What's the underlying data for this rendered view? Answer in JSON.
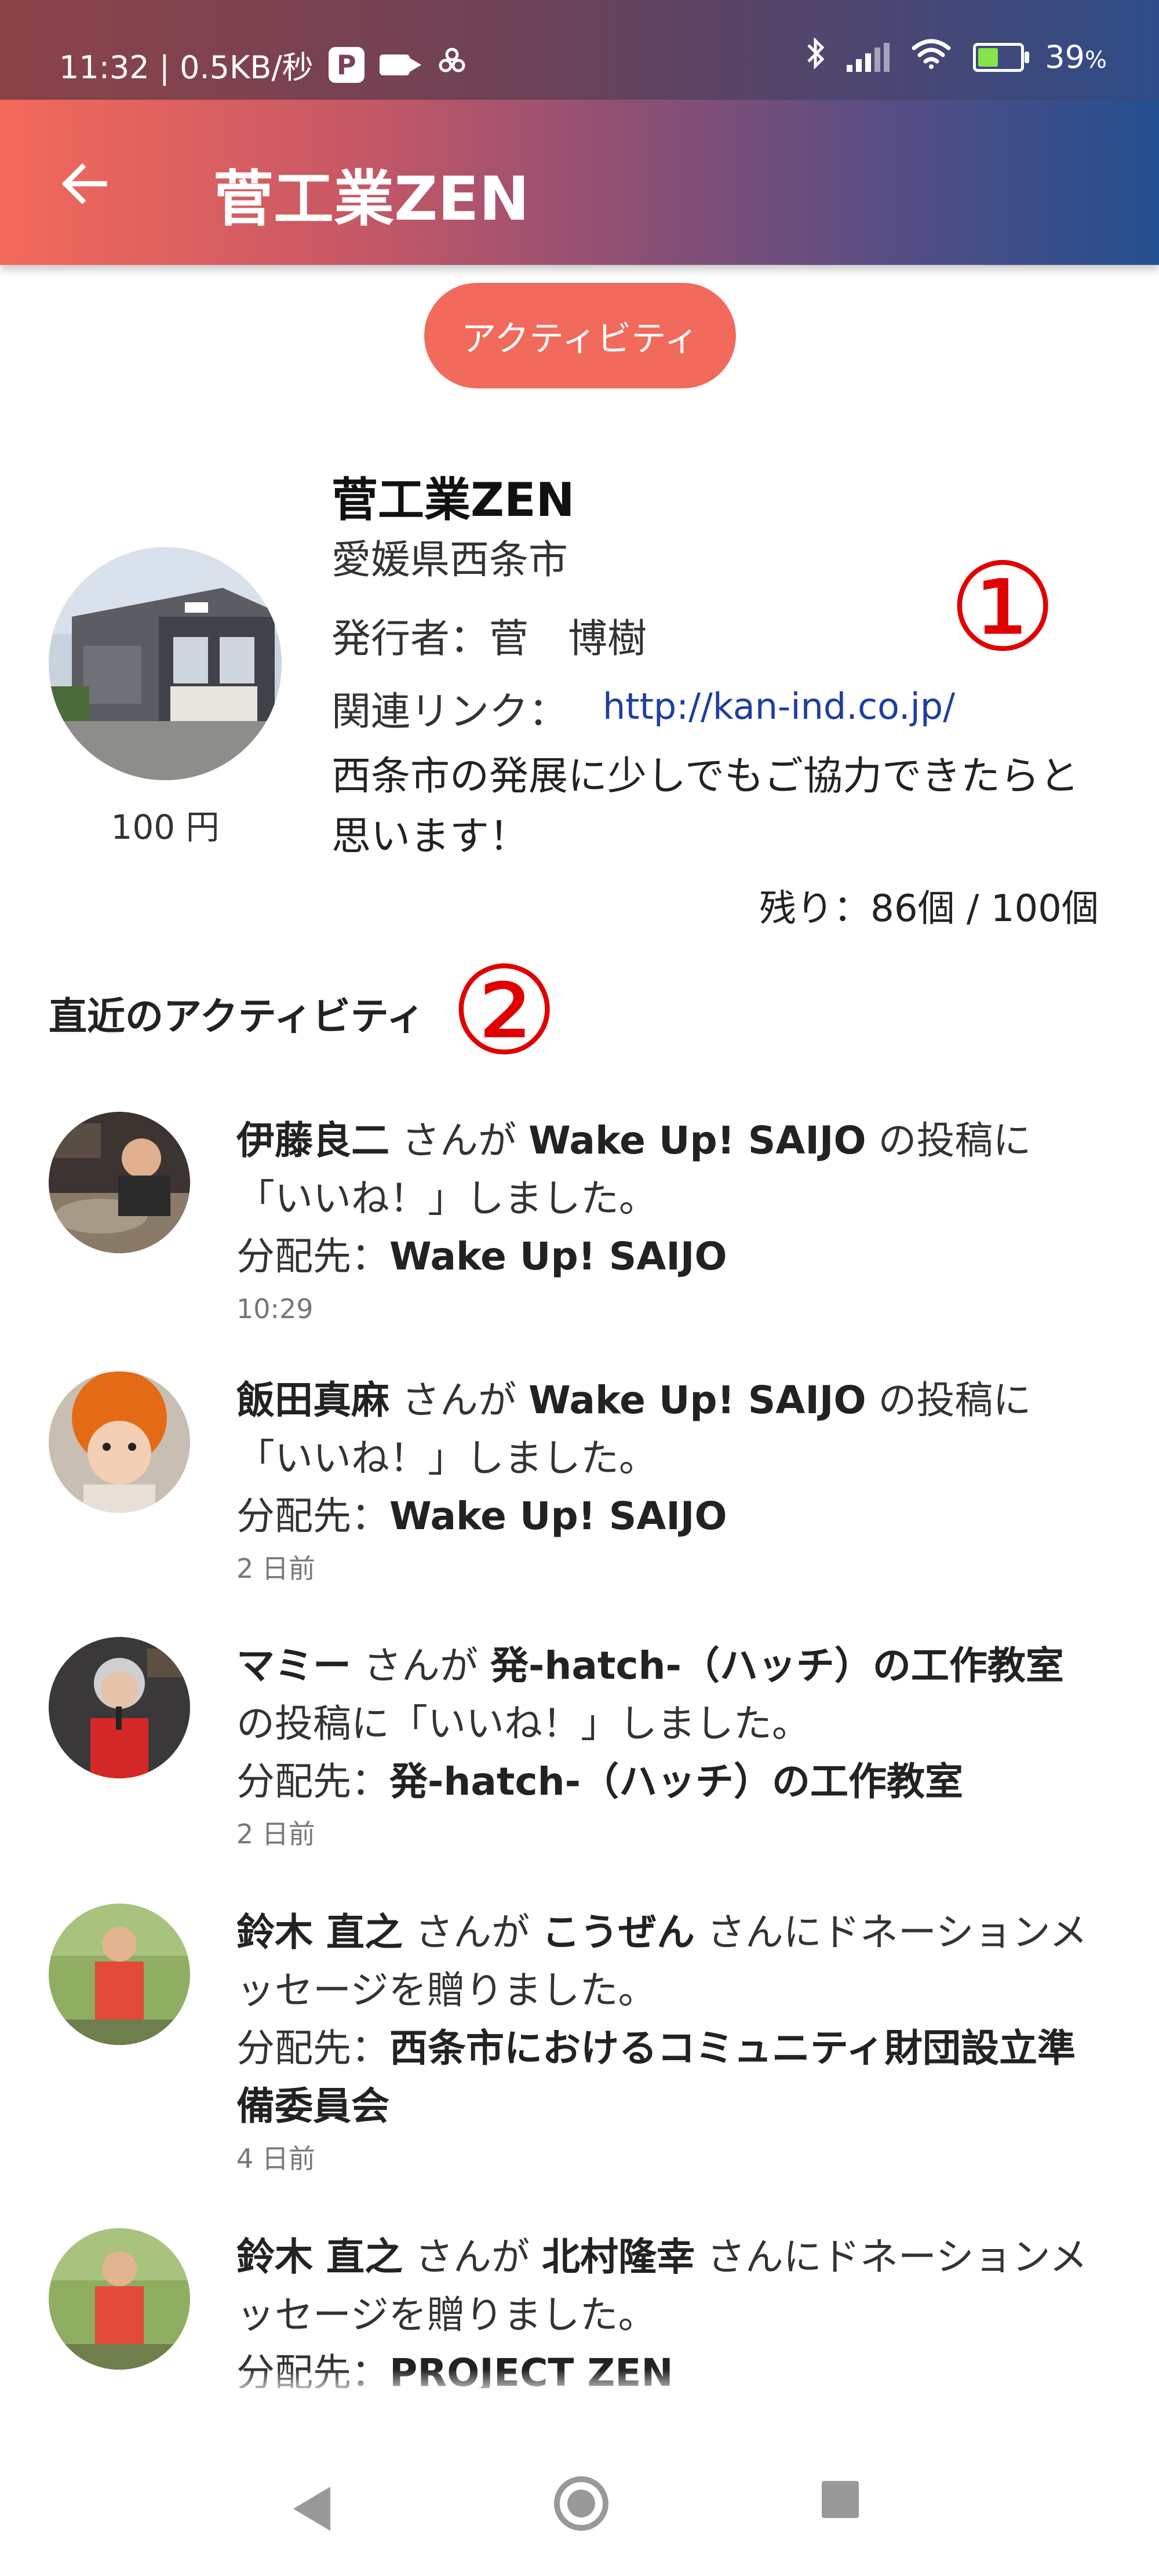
{
  "status_bar": {
    "time_net": "11:32 | 0.5KB/秒",
    "battery": "39",
    "battery_unit": "%"
  },
  "app_bar": {
    "title": "菅工業ZEN"
  },
  "tab_button": {
    "label": "アクティビティ"
  },
  "profile": {
    "name": "菅工業ZEN",
    "location": "愛媛県西条市",
    "issuer": "発行者：菅　博樹",
    "link_label": "関連リンク：",
    "link_url": "http://kan-ind.co.jp/",
    "description": "西条市の発展に少しでもご協力できたらと思います！",
    "price": "100 円",
    "remaining": "残り：86個 / 100個"
  },
  "annotations": {
    "one": "①",
    "two": "②"
  },
  "section_title": "直近のアクティビティ",
  "activities": [
    {
      "user": "伊藤良二",
      "p1": " さんが ",
      "target": "Wake Up! SAIJO",
      "p2": " の投稿に「いいね！」しました。",
      "dist_label": "分配先：",
      "dist": "Wake Up! SAIJO",
      "time": "10:29"
    },
    {
      "user": "飯田真麻",
      "p1": " さんが ",
      "target": "Wake Up! SAIJO",
      "p2": " の投稿に「いいね！」しました。",
      "dist_label": "分配先：",
      "dist": "Wake Up! SAIJO",
      "time": "2 日前"
    },
    {
      "user": "マミー",
      "p1": " さんが ",
      "target": "発-hatch-（ハッチ）の工作教室",
      "p2": " の投稿に「いいね！」しました。",
      "dist_label": "分配先：",
      "dist": "発-hatch-（ハッチ）の工作教室",
      "time": "2 日前"
    },
    {
      "user": "鈴木 直之",
      "p1": " さんが ",
      "target": "こうぜん",
      "p2": " さんにドネーションメッセージを贈りました。",
      "dist_label": "分配先：",
      "dist": "西条市におけるコミュニティ財団設立準備委員会",
      "time": "4 日前"
    },
    {
      "user": "鈴木 直之",
      "p1": " さんが ",
      "target": "北村隆幸",
      "p2": " さんにドネーションメッセージを贈りました。",
      "dist_label": "分配先：",
      "dist": "PROJECT ZEN",
      "time": ""
    }
  ],
  "icons": {
    "back": "arrow-left-icon",
    "nav": [
      "back-triangle-icon",
      "home-circle-icon",
      "recents-square-icon"
    ]
  }
}
